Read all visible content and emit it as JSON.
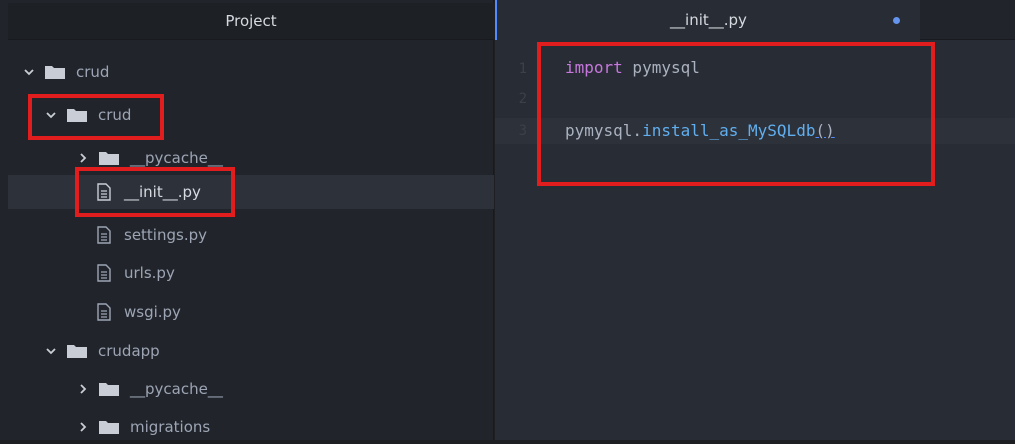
{
  "project_panel": {
    "title": "Project",
    "tree": [
      {
        "label": "crud",
        "kind": "folder",
        "expanded": true,
        "icon": "folder-icon"
      },
      {
        "label": "crud",
        "kind": "folder",
        "expanded": true,
        "icon": "folder-icon"
      },
      {
        "label": "__pycache__",
        "kind": "folder",
        "expanded": false,
        "icon": "folder-icon"
      },
      {
        "label": "__init__.py",
        "kind": "file",
        "selected": true,
        "icon": "file-text-icon"
      },
      {
        "label": "settings.py",
        "kind": "file",
        "icon": "file-text-icon"
      },
      {
        "label": "urls.py",
        "kind": "file",
        "icon": "file-text-icon"
      },
      {
        "label": "wsgi.py",
        "kind": "file",
        "icon": "file-text-icon"
      },
      {
        "label": "crudapp",
        "kind": "folder",
        "expanded": true,
        "icon": "folder-icon"
      },
      {
        "label": "__pycache__",
        "kind": "folder",
        "expanded": false,
        "icon": "folder-icon"
      },
      {
        "label": "migrations",
        "kind": "folder",
        "expanded": false,
        "icon": "folder-icon"
      }
    ]
  },
  "editor": {
    "tab_label": "__init__.py",
    "modified_indicator": "modified-dot",
    "line_numbers": [
      "1",
      "2",
      "3"
    ],
    "lines": {
      "l1_keyword": "import",
      "l1_rest": " pymysql",
      "l3_obj": "pymysql.",
      "l3_fn": "install_as_MySQLdb",
      "l3_parens": "()"
    }
  },
  "colors": {
    "highlight": "#e21d1d",
    "keyword": "#c678dd",
    "function": "#61afef",
    "accent": "#528bff"
  }
}
